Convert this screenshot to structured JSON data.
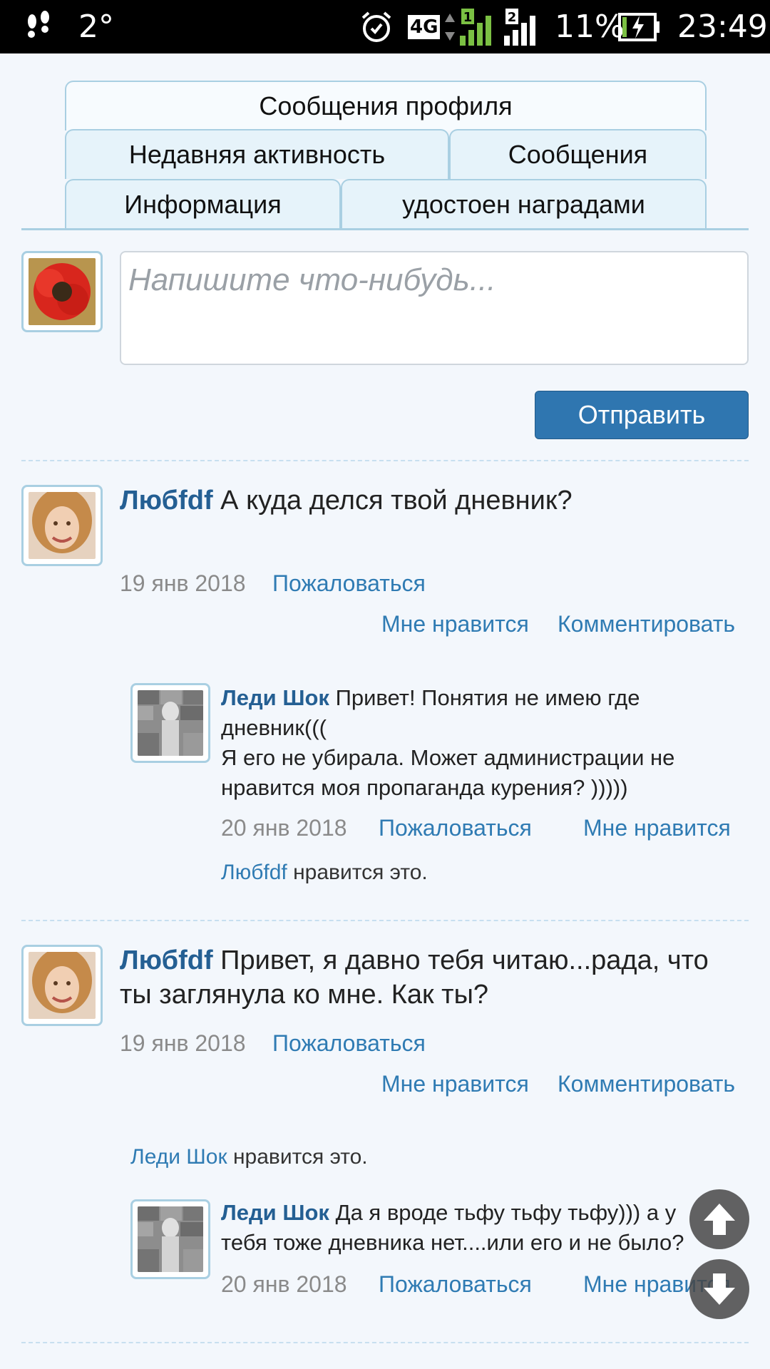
{
  "status": {
    "temperature": "2°",
    "battery": "11%",
    "time": "23:49",
    "network": "4G",
    "sim1": "1",
    "sim2": "2"
  },
  "tabs": {
    "profile_posts": "Сообщения профиля",
    "recent_activity": "Недавняя активность",
    "messages": "Сообщения",
    "information": "Информация",
    "awards": "удостоен наградами"
  },
  "composer": {
    "placeholder": "Напишите что-нибудь...",
    "send_label": "Отправить"
  },
  "posts": [
    {
      "author": "Любfdf",
      "text": "А куда делся твой дневник?",
      "date": "19 янв 2018",
      "report": "Пожаловаться",
      "like": "Мне нравится",
      "comment": "Комментировать",
      "reply": {
        "author": "Леди Шок",
        "line1": "Привет! Понятия не имею где",
        "line2": "дневник(((",
        "line3": "Я его не убирала. Может администрации не",
        "line4": "нравится моя пропаганда курения? )))))",
        "date": "20 янв 2018",
        "report": "Пожаловаться",
        "like": "Мне нравится",
        "likes_user": "Любfdf",
        "likes_suffix": " нравится это."
      }
    },
    {
      "author": "Любfdf",
      "line1": "Привет, я давно тебя читаю...рада, что",
      "line2": "ты заглянула ко мне. Как ты?",
      "date": "19 янв 2018",
      "report": "Пожаловаться",
      "like": "Мне нравится",
      "comment": "Комментировать",
      "likes_user": "Леди Шок",
      "likes_suffix": " нравится это.",
      "reply": {
        "author": "Леди Шок",
        "line1": "Да я вроде тьфу тьфу тьфу))) а у",
        "line2": "тебя тоже дневника нет....или его и не было?",
        "date": "20 янв 2018",
        "report": "Пожаловаться",
        "like": "Мне нравится"
      }
    }
  ],
  "colors": {
    "link": "#2f7bb3",
    "author": "#245f93",
    "button": "#2f76b0",
    "tab_border": "#a9cfe2"
  }
}
